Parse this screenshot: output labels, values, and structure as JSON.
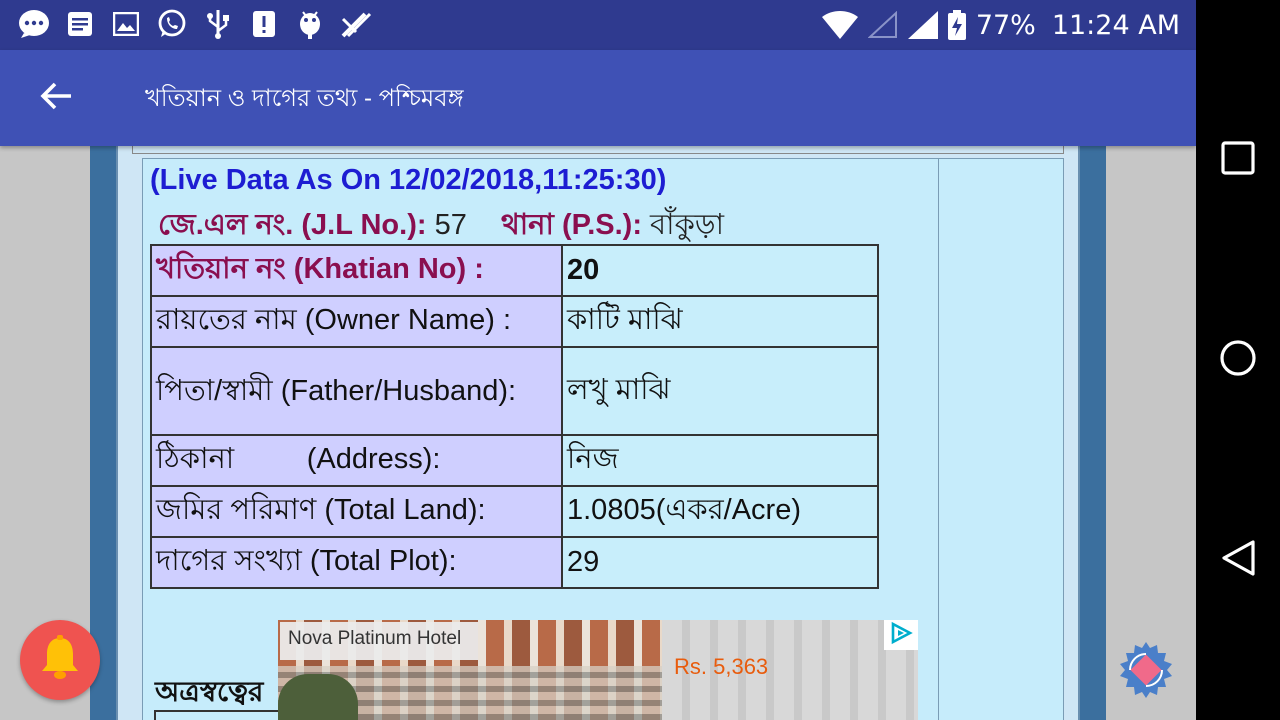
{
  "status_bar": {
    "battery": "77%",
    "time": "11:24 AM"
  },
  "toolbar": {
    "title": "খতিয়ান ও দাগের তথ্য - পশ্চিমবঙ্গ"
  },
  "record": {
    "live_data": "(Live Data As On 12/02/2018,11:25:30)",
    "jl_label": "জে.এল নং. (J.L No.):",
    "jl_value": "57",
    "ps_label": "থানা (P.S.):",
    "ps_value": "বাঁকুড়া",
    "rows": [
      {
        "label": "খতিয়ান নং   (Khatian No) :",
        "value": "20"
      },
      {
        "label": "রায়তের নাম   (Owner Name) :",
        "value": "কাটি মাঝি"
      },
      {
        "label": "পিতা/স্বামী (Father/Husband):",
        "value": "লখু মাঝি"
      },
      {
        "label": "ঠিকানা         (Address):",
        "value": "নিজ"
      },
      {
        "label": "জমির পরিমাণ (Total Land):",
        "value": "1.0805(একর/Acre)"
      },
      {
        "label": "দাগের সংখ্যা (Total Plot):",
        "value": "29"
      }
    ],
    "sub_heading": "অত্রস্বত্বের"
  },
  "ad": {
    "title": "Nova Platinum Hotel",
    "price": "Rs. 5,363"
  },
  "colors": {
    "status_bar": "#2f3a8f",
    "toolbar": "#3f51b5",
    "live_text": "#1d1dd2",
    "label_highlight": "#8a0f4f",
    "bell_fab": "#ef5350",
    "ad_price": "#e85c0d"
  }
}
